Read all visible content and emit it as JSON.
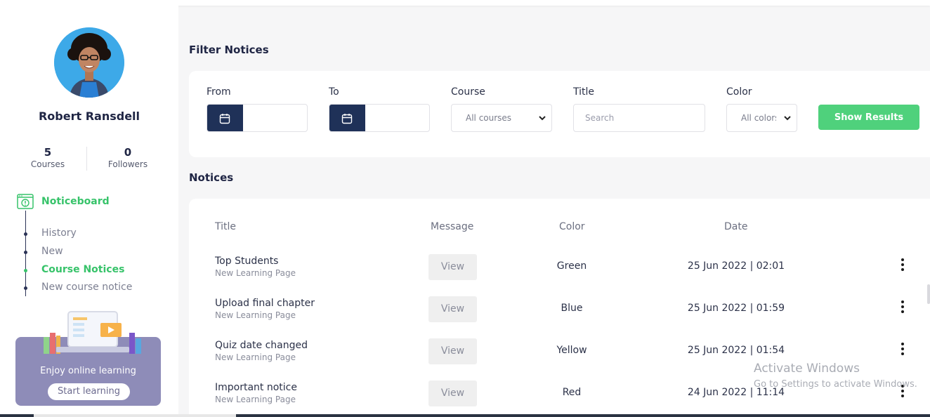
{
  "user": {
    "name": "Robert Ransdell",
    "stats": [
      {
        "value": "5",
        "label": "Courses"
      },
      {
        "value": "0",
        "label": "Followers"
      }
    ]
  },
  "sidebar": {
    "section_label": "Noticeboard",
    "items": [
      {
        "label": "History",
        "active": false
      },
      {
        "label": "New",
        "active": false
      },
      {
        "label": "Course Notices",
        "active": true
      },
      {
        "label": "New course notice",
        "active": false
      }
    ],
    "promo": {
      "text": "Enjoy online learning",
      "button": "Start learning"
    }
  },
  "filter": {
    "title": "Filter Notices",
    "from_label": "From",
    "to_label": "To",
    "course_label": "Course",
    "course_value": "All courses",
    "title_label": "Title",
    "title_placeholder": "Search",
    "color_label": "Color",
    "color_value": "All colors",
    "submit": "Show Results"
  },
  "notices": {
    "title": "Notices",
    "columns": [
      "Title",
      "Message",
      "Color",
      "Date"
    ],
    "view_label": "View",
    "rows": [
      {
        "title": "Top Students",
        "subtitle": "New Learning Page",
        "color": "Green",
        "date": "25 Jun 2022 | 02:01"
      },
      {
        "title": "Upload final chapter",
        "subtitle": "New Learning Page",
        "color": "Blue",
        "date": "25 Jun 2022 | 01:59"
      },
      {
        "title": "Quiz date changed",
        "subtitle": "New Learning Page",
        "color": "Yellow",
        "date": "25 Jun 2022 | 01:54"
      },
      {
        "title": "Important notice",
        "subtitle": "New Learning Page",
        "color": "Red",
        "date": "24 Jun 2022 | 11:14"
      }
    ]
  },
  "watermark": {
    "line1": "Activate Windows",
    "line2": "Go to Settings to activate Windows."
  },
  "colors": {
    "accent_green": "#37c36a",
    "button_green": "#4fd17c",
    "navy": "#1f3158",
    "promo_purple": "#8e8cb8"
  }
}
